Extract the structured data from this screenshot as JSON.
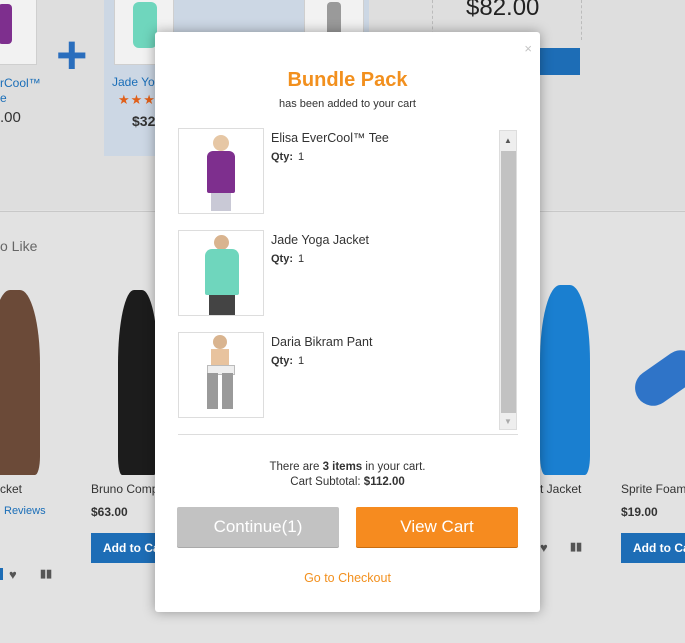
{
  "background": {
    "top_product_left": {
      "name_line1": "rCool™",
      "name_line2": "e",
      "price": ".00"
    },
    "top_product_mid": {
      "name": "Jade Yog",
      "price": "$32"
    },
    "bundle_price": "$82.00",
    "section_title": "o Like",
    "products": [
      {
        "name": "cket",
        "reviews": "Reviews"
      },
      {
        "name": "Bruno Comp",
        "price": "$63.00",
        "add_label": "Add to Ca"
      },
      {
        "name": "t Jacket"
      },
      {
        "name": "Sprite Foam",
        "price": "$19.00",
        "add_label": "Add to Ca"
      }
    ]
  },
  "modal": {
    "close_label": "×",
    "title": "Bundle Pack",
    "subtitle": "has been added to your cart",
    "qty_label": "Qty:",
    "items": [
      {
        "name": "Elisa EverCool™ Tee",
        "qty": "1",
        "color": "#7e2f8e"
      },
      {
        "name": "Jade Yoga Jacket",
        "qty": "1",
        "color": "#6fd6bd"
      },
      {
        "name": "Daria Bikram Pant",
        "qty": "1",
        "color": "#9a9a9a"
      }
    ],
    "summary": {
      "prefix": "There are",
      "count": "3 items",
      "suffix": "in your cart.",
      "subtotal_label": "Cart Subtotal:",
      "subtotal_value": "$112.00"
    },
    "continue_label": "Continue(1)",
    "view_cart_label": "View Cart",
    "checkout_label": "Go to Checkout"
  },
  "colors": {
    "accent": "#f68b1f",
    "link": "#1a6eb8",
    "overlay": "#dcdcdc"
  }
}
